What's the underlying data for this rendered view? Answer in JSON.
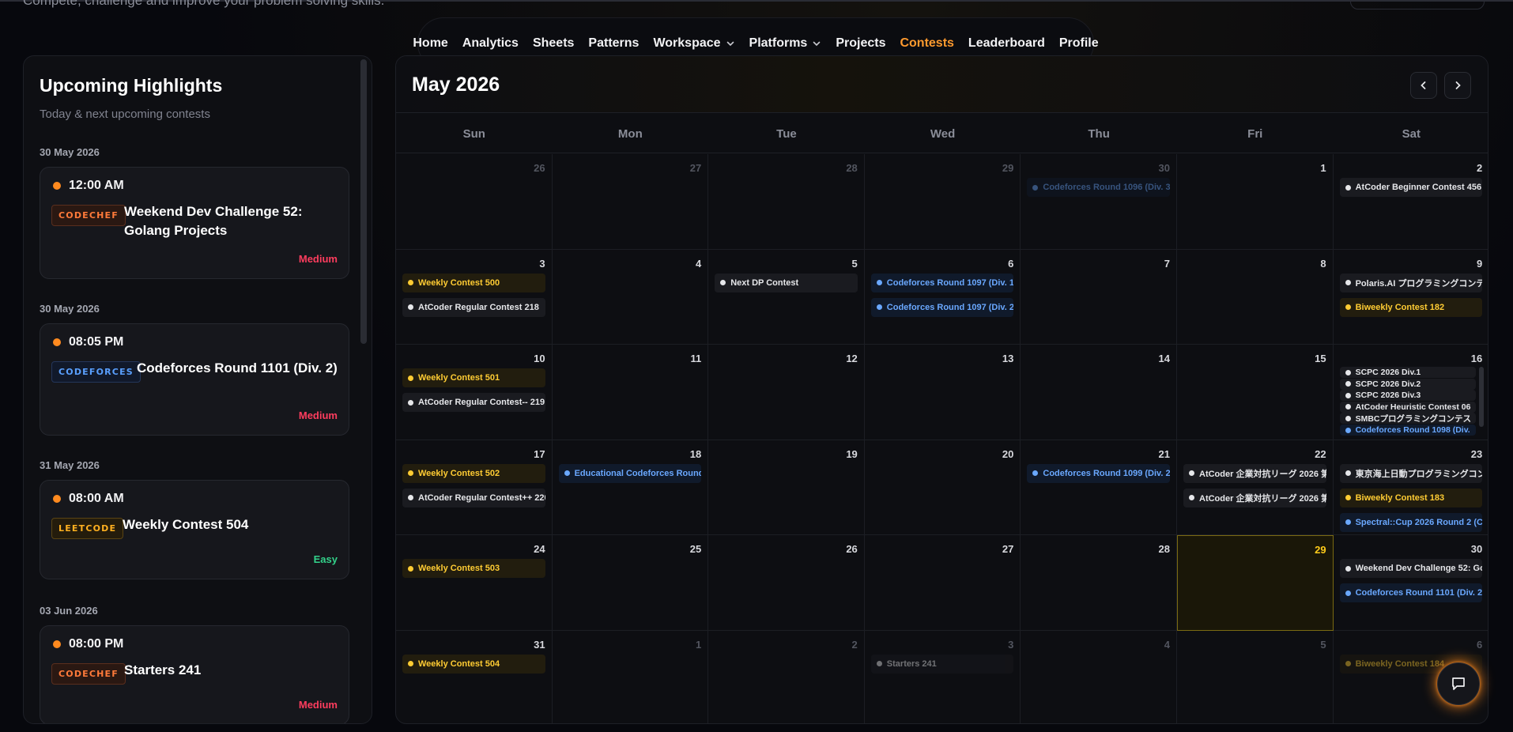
{
  "page": {
    "tagline": "Compete, challenge and improve your problem solving skills."
  },
  "nav": {
    "items": [
      {
        "label": "Home"
      },
      {
        "label": "Analytics"
      },
      {
        "label": "Sheets"
      },
      {
        "label": "Patterns"
      },
      {
        "label": "Workspace",
        "dropdown": true
      },
      {
        "label": "Platforms",
        "dropdown": true
      },
      {
        "label": "Projects"
      },
      {
        "label": "Contests",
        "active": true
      },
      {
        "label": "Leaderboard"
      },
      {
        "label": "Profile"
      }
    ],
    "accent": "#ff8a1f"
  },
  "highlights": {
    "title": "Upcoming Highlights",
    "subtitle": "Today & next upcoming contests",
    "items": [
      {
        "date": "30 May 2026",
        "time": "12:00 AM",
        "platform": "CODECHEF",
        "title": "Weekend Dev Challenge 52: Golang Projects",
        "difficulty": "Medium"
      },
      {
        "date": "30 May 2026",
        "time": "08:05 PM",
        "platform": "CODEFORCES",
        "title": "Codeforces Round 1101 (Div. 2)",
        "difficulty": "Medium"
      },
      {
        "date": "31 May 2026",
        "time": "08:00 AM",
        "platform": "LEETCODE",
        "title": "Weekly Contest 504",
        "difficulty": "Easy"
      },
      {
        "date": "03 Jun 2026",
        "time": "08:00 PM",
        "platform": "CODECHEF",
        "title": "Starters 241",
        "difficulty": "Medium"
      }
    ]
  },
  "calendar": {
    "title": "May 2026",
    "days_of_week": [
      "Sun",
      "Mon",
      "Tue",
      "Wed",
      "Thu",
      "Fri",
      "Sat"
    ],
    "today": 29,
    "events": {
      "w0": [
        {
          "day": "30",
          "col": 4,
          "events": [
            {
              "t": "Codeforces Round 1096 (Div. 3)",
              "k": "cf",
              "faded": true
            }
          ]
        },
        {
          "day": "2",
          "col": 6,
          "events": [
            {
              "t": "AtCoder Beginner Contest 456",
              "k": "gr"
            }
          ]
        }
      ],
      "w1": [
        {
          "day": "3",
          "col": 0,
          "events": [
            {
              "t": "Weekly Contest 500",
              "k": "lc"
            },
            {
              "t": "AtCoder Regular Contest 218",
              "k": "gr"
            }
          ]
        },
        {
          "day": "5",
          "col": 2,
          "events": [
            {
              "t": "Next DP Contest",
              "k": "gr"
            }
          ]
        },
        {
          "day": "6",
          "col": 3,
          "events": [
            {
              "t": "Codeforces Round 1097 (Div. 1,",
              "k": "cf"
            },
            {
              "t": "Codeforces Round 1097 (Div. 2,",
              "k": "cf"
            }
          ]
        },
        {
          "day": "9",
          "col": 6,
          "events": [
            {
              "t": "Polaris.AI プログラミングコンテ",
              "k": "gr"
            },
            {
              "t": "Biweekly Contest 182",
              "k": "lc"
            }
          ]
        }
      ],
      "w2": [
        {
          "day": "10",
          "col": 0,
          "events": [
            {
              "t": "Weekly Contest 501",
              "k": "lc"
            },
            {
              "t": "AtCoder Regular Contest-- 219",
              "k": "gr"
            }
          ]
        }
      ],
      "w2_sat16": [
        "SCPC 2026 Div.1",
        "SCPC 2026 Div.2",
        "SCPC 2026 Div.3",
        "AtCoder Heuristic Contest 06",
        "SMBCプログラミングコンテス",
        "Codeforces Round 1098 (Div."
      ],
      "w3": [
        {
          "day": "17",
          "col": 0,
          "events": [
            {
              "t": "Weekly Contest 502",
              "k": "lc"
            },
            {
              "t": "AtCoder Regular Contest++ 220",
              "k": "gr"
            }
          ]
        },
        {
          "day": "18",
          "col": 1,
          "events": [
            {
              "t": "Educational Codeforces Round",
              "k": "cf"
            }
          ]
        },
        {
          "day": "21",
          "col": 4,
          "events": [
            {
              "t": "Codeforces Round 1099 (Div. 2)",
              "k": "cf"
            }
          ]
        },
        {
          "day": "22",
          "col": 5,
          "events": [
            {
              "t": "AtCoder 企業対抗リーグ 2026 第",
              "k": "gr"
            },
            {
              "t": "AtCoder 企業対抗リーグ 2026 第",
              "k": "gr"
            }
          ]
        },
        {
          "day": "23",
          "col": 6,
          "events": [
            {
              "t": "東京海上日動プログラミングコン",
              "k": "gr"
            },
            {
              "t": "Biweekly Contest 183",
              "k": "lc"
            },
            {
              "t": "Spectral::Cup 2026 Round 2 (Co",
              "k": "cf"
            }
          ]
        }
      ],
      "w4": [
        {
          "day": "24",
          "col": 0,
          "events": [
            {
              "t": "Weekly Contest 503",
              "k": "lc"
            }
          ]
        },
        {
          "day": "30",
          "col": 6,
          "events": [
            {
              "t": "Weekend Dev Challenge 52: Go",
              "k": "gr"
            },
            {
              "t": "Codeforces Round 1101 (Div. 2)",
              "k": "cf"
            }
          ]
        }
      ],
      "w5": [
        {
          "day": "31",
          "col": 0,
          "events": [
            {
              "t": "Weekly Contest 504",
              "k": "lc"
            }
          ]
        },
        {
          "day": "3",
          "col": 3,
          "events": [
            {
              "t": "Starters 241",
              "k": "gr",
              "faded": true
            }
          ]
        },
        {
          "day": "6",
          "col": 6,
          "events": [
            {
              "t": "Biweekly Contest 184",
              "k": "lc",
              "faded": true
            }
          ]
        }
      ]
    },
    "weeks": [
      [
        {
          "n": "26",
          "dim": true
        },
        {
          "n": "27",
          "dim": true
        },
        {
          "n": "28",
          "dim": true
        },
        {
          "n": "29",
          "dim": true
        },
        {
          "n": "30",
          "dim": true
        },
        {
          "n": "1"
        },
        {
          "n": "2"
        }
      ],
      [
        {
          "n": "3"
        },
        {
          "n": "4"
        },
        {
          "n": "5"
        },
        {
          "n": "6"
        },
        {
          "n": "7"
        },
        {
          "n": "8"
        },
        {
          "n": "9"
        }
      ],
      [
        {
          "n": "10"
        },
        {
          "n": "11"
        },
        {
          "n": "12"
        },
        {
          "n": "13"
        },
        {
          "n": "14"
        },
        {
          "n": "15"
        },
        {
          "n": "16"
        }
      ],
      [
        {
          "n": "17"
        },
        {
          "n": "18"
        },
        {
          "n": "19"
        },
        {
          "n": "20"
        },
        {
          "n": "21"
        },
        {
          "n": "22"
        },
        {
          "n": "23"
        }
      ],
      [
        {
          "n": "24"
        },
        {
          "n": "25"
        },
        {
          "n": "26"
        },
        {
          "n": "27"
        },
        {
          "n": "28"
        },
        {
          "n": "29",
          "today": true
        },
        {
          "n": "30"
        }
      ],
      [
        {
          "n": "31"
        },
        {
          "n": "1",
          "dim": true
        },
        {
          "n": "2",
          "dim": true
        },
        {
          "n": "3",
          "dim": true
        },
        {
          "n": "4",
          "dim": true
        },
        {
          "n": "5",
          "dim": true
        },
        {
          "n": "6",
          "dim": true
        }
      ]
    ]
  },
  "icons": {
    "prev": "chevron-left-icon",
    "next": "chevron-right-icon",
    "chat": "chat-bubble-icon",
    "dropdown": "chevron-down-icon"
  }
}
